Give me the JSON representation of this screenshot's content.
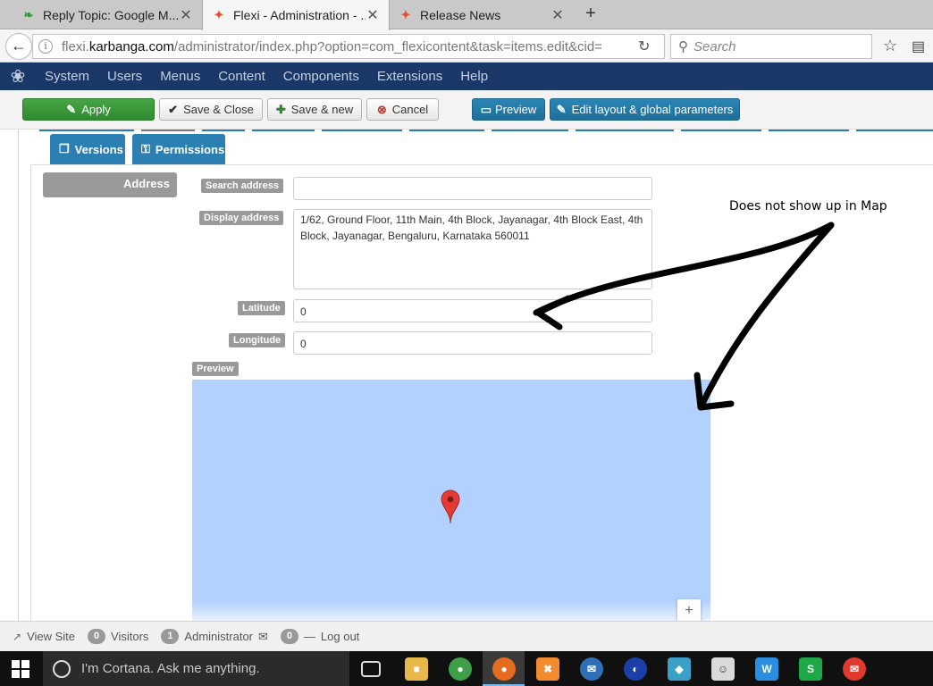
{
  "browser": {
    "tabs": [
      {
        "title": "Reply Topic: Google M...",
        "icon": "n-leaf-icon",
        "active": false
      },
      {
        "title": "Flexi - Administration - ...",
        "icon": "joomla-icon",
        "active": true
      },
      {
        "title": "Release News",
        "icon": "joomla-icon",
        "active": false
      }
    ],
    "new_tab": "+",
    "url_prefix": "flexi.",
    "url_domain": "karbanga.com",
    "url_rest": "/administrator/index.php?option=com_flexicontent&task=items.edit&cid=",
    "search_placeholder": "Search"
  },
  "admin_menu": {
    "items": [
      "System",
      "Users",
      "Menus",
      "Content",
      "Components",
      "Extensions",
      "Help"
    ]
  },
  "toolbar": {
    "apply": "Apply",
    "save_close": "Save & Close",
    "save_new": "Save & new",
    "cancel": "Cancel",
    "preview": "Preview",
    "edit_layout": "Edit layout & global parameters"
  },
  "form": {
    "tabs": [
      "Versions",
      "Permissions"
    ],
    "field_label": "Address",
    "search_address_label": "Search address",
    "search_address_value": "",
    "display_address_label": "Display address",
    "display_address_value": "1/62, Ground Floor, 11th Main, 4th Block, Jayanagar, 4th Block East, 4th Block, Jayanagar, Bengaluru, Karnataka 560011",
    "latitude_label": "Latitude",
    "latitude_value": "0",
    "longitude_label": "Longitude",
    "longitude_value": "0",
    "preview_label": "Preview",
    "map_color": "#b3d1ff",
    "zoom_in": "+"
  },
  "annotation": {
    "text": "Does not show up in Map"
  },
  "statusbar": {
    "view_site": "View Site",
    "visitors_count": "0",
    "visitors": "Visitors",
    "admin_count": "1",
    "administrator": "Administrator",
    "messages_count": "0",
    "logout": "Log out"
  },
  "taskbar": {
    "cortana_text": "I'm Cortana. Ask me anything."
  }
}
